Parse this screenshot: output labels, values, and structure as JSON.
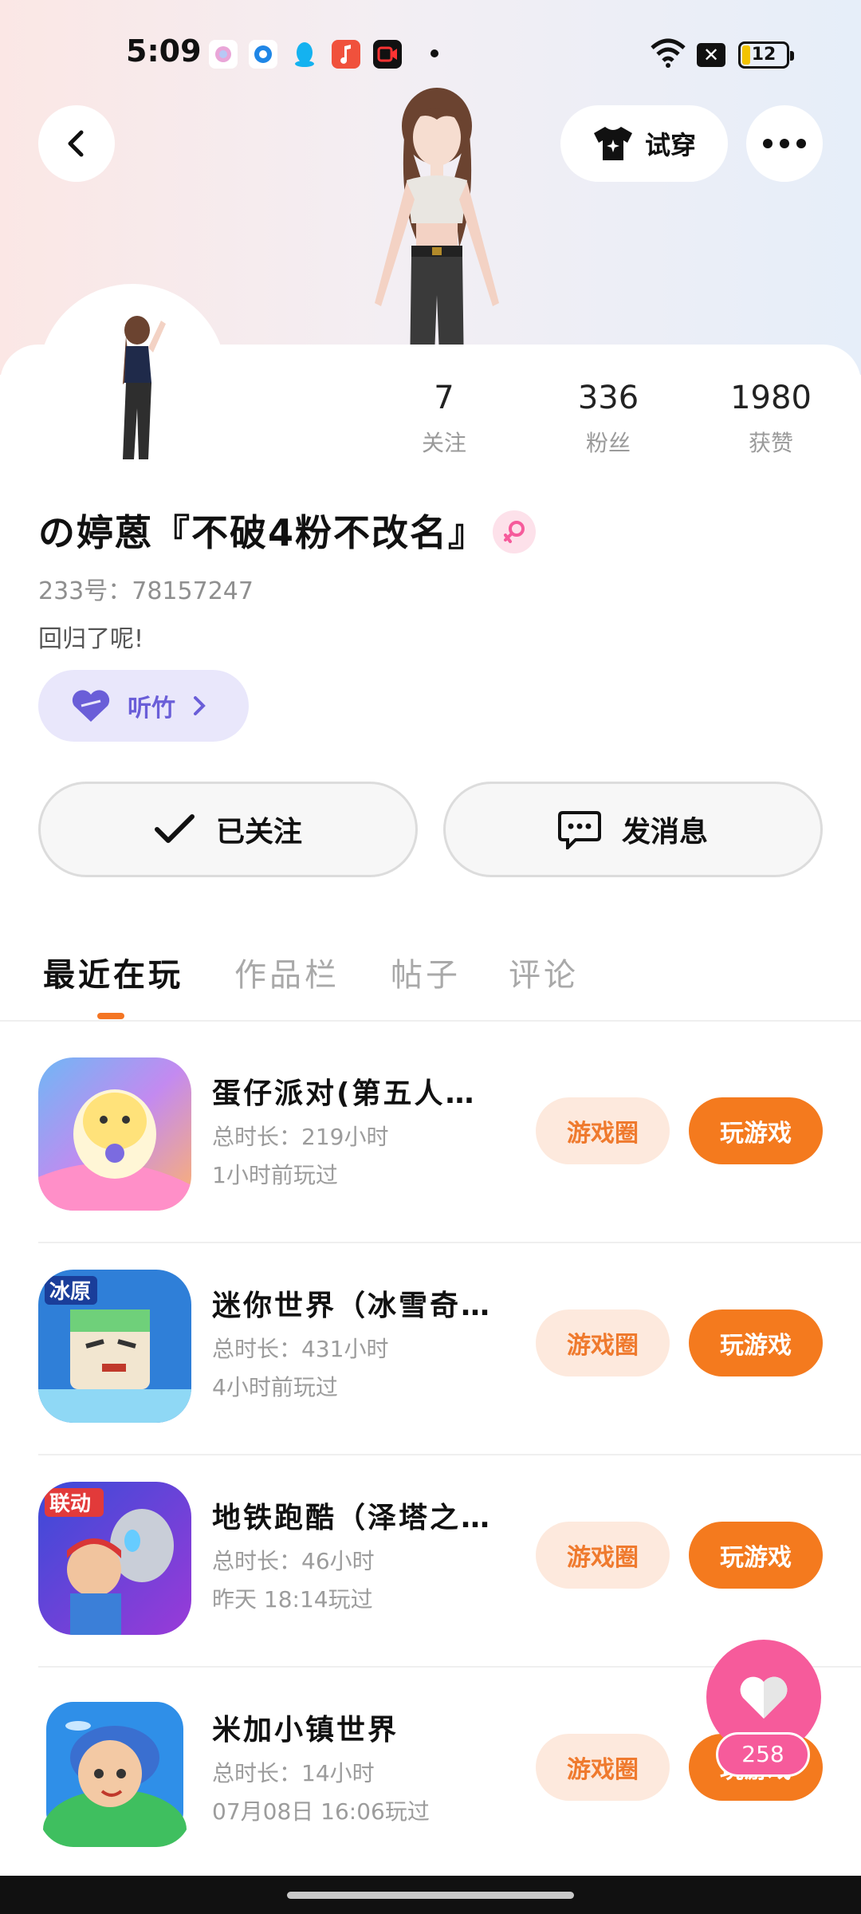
{
  "status_bar": {
    "time": "5:09",
    "battery": "12",
    "icons": [
      "app-icon-pink",
      "app-icon-blue-circle",
      "qq-icon",
      "music-icon",
      "video-icon",
      "wifi-icon",
      "sim-blocked-icon",
      "battery-icon"
    ]
  },
  "header": {
    "tryon_label": "试穿"
  },
  "profile": {
    "stats": [
      {
        "value": "7",
        "label": "关注"
      },
      {
        "value": "336",
        "label": "粉丝"
      },
      {
        "value": "1980",
        "label": "获赞"
      }
    ],
    "username": "の婷蒽『不破4粉不改名』",
    "uid": "233号：78157247",
    "bio": "回归了呢!",
    "music_chip": "听竹"
  },
  "actions": {
    "follow_label": "已关注",
    "message_label": "发消息"
  },
  "tabs": [
    "最近在玩",
    "作品栏",
    "帖子",
    "评论"
  ],
  "games": [
    {
      "name": "蛋仔派对(第五人…",
      "total": "总时长：219小时",
      "last": "1小时前玩过",
      "circle_label": "游戏圈",
      "play_label": "玩游戏"
    },
    {
      "name": "迷你世界（冰雪奇…",
      "total": "总时长：431小时",
      "last": "4小时前玩过",
      "circle_label": "游戏圈",
      "play_label": "玩游戏"
    },
    {
      "name": "地铁跑酷（泽塔之…",
      "total": "总时长：46小时",
      "last": "昨天 18:14玩过",
      "circle_label": "游戏圈",
      "play_label": "玩游戏"
    },
    {
      "name": "米加小镇世界",
      "total": "总时长：14小时",
      "last": "07月08日 16:06玩过",
      "circle_label": "游戏圈",
      "play_label": "玩游戏"
    }
  ],
  "fab": {
    "count": "258"
  },
  "colors": {
    "accent_orange": "#f47a1e",
    "circle_bg": "#fde9dd",
    "like_pink": "#f65b9b",
    "chip_purple": "#6a5ed8"
  }
}
